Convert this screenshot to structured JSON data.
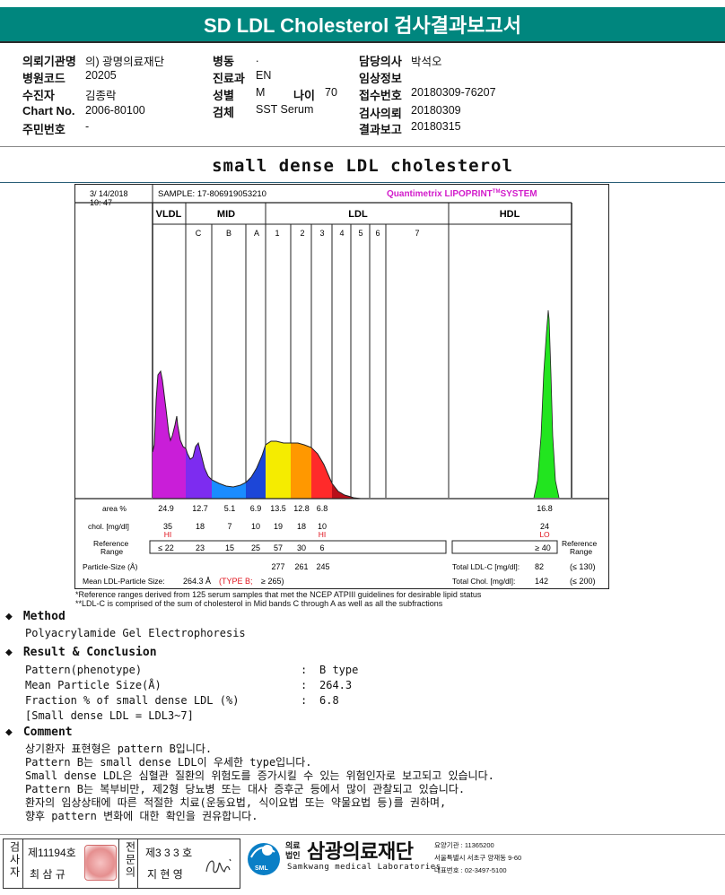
{
  "report_title": "SD LDL Cholesterol 검사결과보고서",
  "info": {
    "col1": [
      {
        "label": "의뢰기관명",
        "value": "의) 광명의료재단"
      },
      {
        "label": "병원코드",
        "value": "20205"
      },
      {
        "label": "수진자",
        "value": "김종락"
      },
      {
        "label": "Chart No.",
        "value": "2006-80100"
      },
      {
        "label": "주민번호",
        "value": "-"
      }
    ],
    "col2": [
      {
        "label": "병동",
        "value": "."
      },
      {
        "label": "진료과",
        "value": "EN"
      },
      {
        "label": "성별",
        "value": "M"
      },
      {
        "label": "검체",
        "value": "SST Serum"
      }
    ],
    "age": {
      "label": "나이",
      "value": "70"
    },
    "col3": [
      {
        "label": "담당의사",
        "value": "박석오"
      },
      {
        "label": "임상정보",
        "value": ""
      },
      {
        "label": "접수번호",
        "value": "20180309-76207"
      },
      {
        "label": "검사의뢰",
        "value": "20180309"
      },
      {
        "label": "결과보고",
        "value": "20180315"
      }
    ]
  },
  "section_title": "small dense LDL cholesterol",
  "chart": {
    "date": "3/ 14/2018",
    "time": "10: 47",
    "sample": "SAMPLE:  17-806919053210",
    "brand": "Quantimetrix LIPOPRINT",
    "brand_tm": "TM",
    "brand_suffix": "SYSTEM",
    "groups": [
      "VLDL",
      "MID",
      "LDL",
      "HDL"
    ],
    "bands": [
      "C",
      "B",
      "A",
      "1",
      "2",
      "3",
      "4",
      "5",
      "6",
      "7"
    ],
    "area_label": "area %",
    "chol_label": "chol. [mg/dl]",
    "ref_label": "Reference Range",
    "particle_label": "Particle-Size (Å)",
    "mean_label": "Mean LDL-Particle Size:",
    "mean_value": "264.3 Å",
    "mean_type": "(TYPE B;",
    "mean_ref": "≥ 265)",
    "total_ldl_label": "Total LDL-C [mg/dl]:",
    "total_ldl_value": "82",
    "total_ldl_ref": "(≤ 130)",
    "total_chol_label": "Total Chol. [mg/dl]:",
    "total_chol_value": "142",
    "total_chol_ref": "(≤ 200)",
    "hi": "HI",
    "lo": "LO"
  },
  "chart_data": {
    "type": "table",
    "title": "small dense LDL cholesterol",
    "columns": [
      "VLDL",
      "C",
      "B",
      "A",
      "1",
      "2",
      "3",
      "HDL"
    ],
    "area_percent": [
      "24.9",
      "12.7",
      "5.1",
      "6.9",
      "13.5",
      "12.8",
      "6.8",
      "16.8"
    ],
    "chol_mg_dl": [
      "35",
      "18",
      "7",
      "10",
      "19",
      "18",
      "10",
      "24"
    ],
    "flags": [
      "HI",
      "",
      "",
      "",
      "",
      "",
      "HI",
      "LO"
    ],
    "reference_range": [
      "≤ 22",
      "23",
      "15",
      "25",
      "57",
      "30",
      "6",
      "≥ 40"
    ],
    "particle_size_A": {
      "1": "277",
      "2": "261",
      "3": "245"
    }
  },
  "footnotes": [
    "*Reference ranges derived from 125 serum samples that met the NCEP ATPIII guidelines for desirable lipid status",
    "**LDL-C is comprised of the sum of cholesterol in Mid bands C through A as well as all the subfractions"
  ],
  "method": {
    "heading": "Method",
    "text": "Polyacrylamide Gel Electrophoresis"
  },
  "result": {
    "heading": "Result & Conclusion",
    "rows": [
      {
        "label": "Pattern(phenotype)",
        "value": "B type"
      },
      {
        "label": "Mean Particle Size(Å)",
        "value": "264.3"
      },
      {
        "label": "Fraction % of small dense LDL (%)",
        "value": "6.8"
      }
    ],
    "note": "[Small dense LDL = LDL3~7]"
  },
  "comment": {
    "heading": "Comment",
    "lines": [
      "상기환자 표현형은 pattern B입니다.",
      "Pattern B는 small dense LDL이 우세한 type입니다.",
      "Small dense LDL은 심혈관 질환의 위험도를 증가시킬 수 있는 위험인자로 보고되고 있습니다.",
      "Pattern B는 복부비만, 제2형 당뇨병 또는 대사 증후군 등에서 많이 관찰되고 있습니다.",
      "환자의 임상상태에 따른 적절한 치료(운동요법, 식이요법 또는 약물요법 등)를 권하며,",
      "향후 pattern 변화에 대한 확인을 권유합니다."
    ]
  },
  "footer": {
    "label1": "검사자",
    "no1": "제11194호",
    "name1": "최 삼 규",
    "label2": "전문의",
    "no2": "제3 3 3 호",
    "name2": "지 현 영",
    "org_small1": "의료",
    "org_small2": "법인",
    "org_name": "삼광의료재단",
    "org_en": "Samkwang medical Laboratories",
    "logo_text": "SML",
    "contact": [
      "요양기관 : 11365200",
      "서울특별시 서초구 양재동 9-60",
      "대표번호 : 02-3497-5100"
    ]
  }
}
